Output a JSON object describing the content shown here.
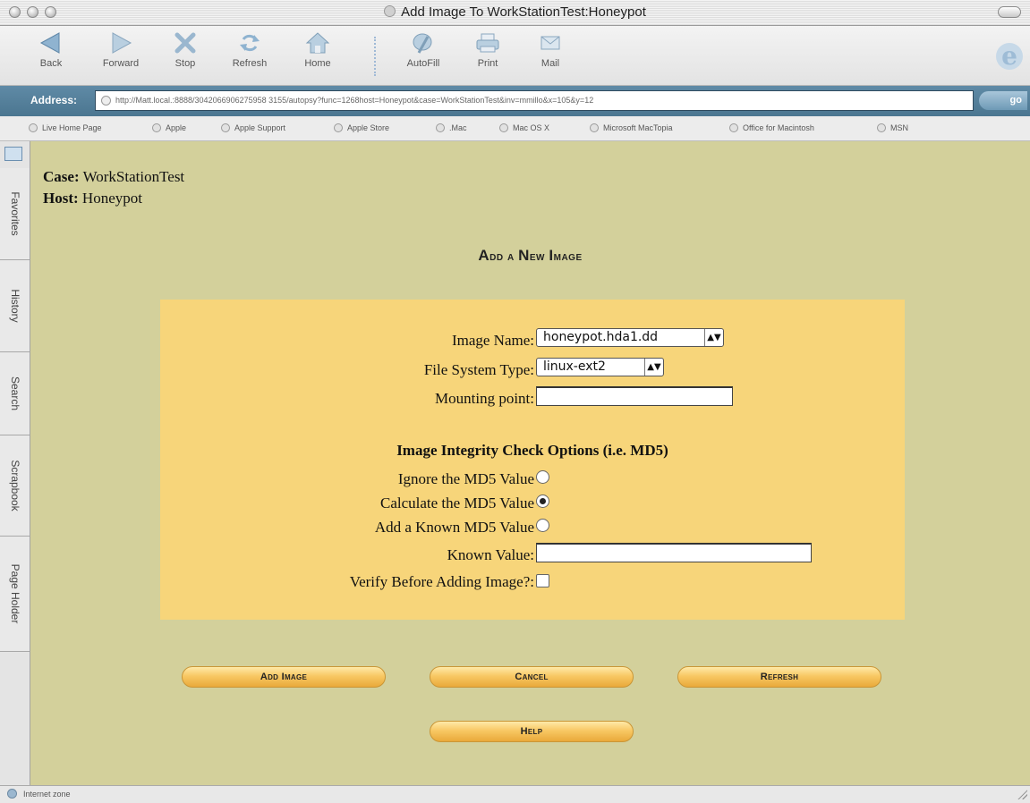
{
  "window": {
    "title": "Add Image To WorkStationTest:Honeypot"
  },
  "toolbar": {
    "back": "Back",
    "forward": "Forward",
    "stop": "Stop",
    "refresh": "Refresh",
    "home": "Home",
    "autofill": "AutoFill",
    "print": "Print",
    "mail": "Mail"
  },
  "address": {
    "label": "Address:",
    "url": "http://Matt.local.:8888/3042066906275958 3155/autopsy?func=1268host=Honeypot&case=WorkStationTest&inv=mmillo&x=105&y=12",
    "go": "go"
  },
  "favorites": [
    "Live Home Page",
    "Apple",
    "Apple Support",
    "Apple Store",
    ".Mac",
    "Mac OS X",
    "Microsoft MacTopia",
    "Office for Macintosh",
    "MSN"
  ],
  "sidetabs": [
    "Favorites",
    "History",
    "Search",
    "Scrapbook",
    "Page Holder"
  ],
  "page": {
    "case_label": "Case:",
    "case_value": "WorkStationTest",
    "host_label": "Host:",
    "host_value": "Honeypot",
    "heading_first": "A",
    "heading_rest": "dd a ",
    "heading_n": "N",
    "heading_ew": "ew ",
    "heading_i": "I",
    "heading_mage": "mage"
  },
  "form": {
    "image_name_label": "Image Name:",
    "image_name_value": "honeypot.hda1.dd",
    "fs_type_label": "File System Type:",
    "fs_type_value": "linux-ext2",
    "mount_label": "Mounting point:",
    "mount_value": "",
    "integrity_heading": "Image Integrity Check Options (i.e. MD5)",
    "ignore_md5_label": "Ignore the MD5 Value",
    "calc_md5_label": "Calculate the MD5 Value",
    "known_md5_label": "Add a Known MD5 Value",
    "known_value_label": "Known Value:",
    "known_value": "",
    "verify_label": "Verify Before Adding Image?:",
    "selected_md5_option": "calculate"
  },
  "buttons": {
    "add_image": "Add Image",
    "cancel": "Cancel",
    "refresh": "Refresh",
    "help": "Help"
  },
  "status": {
    "zone": "Internet zone"
  }
}
